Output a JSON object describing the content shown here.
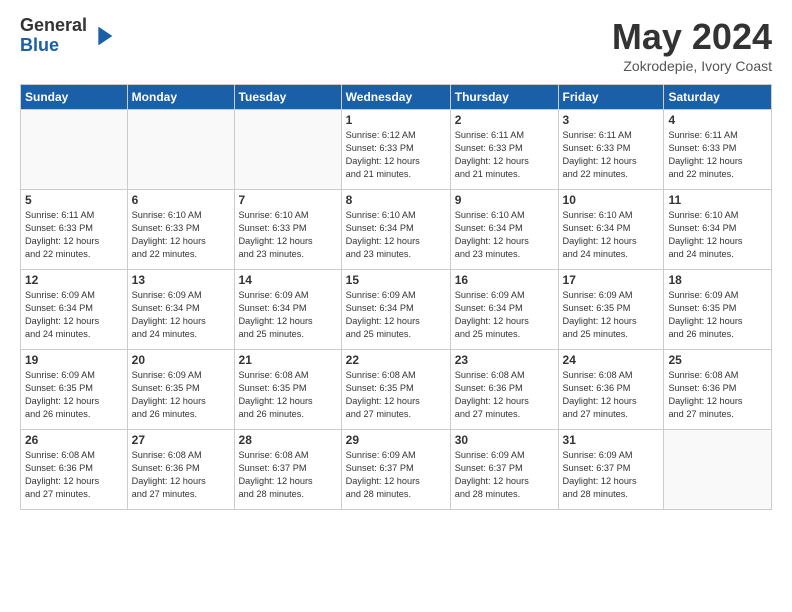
{
  "logo": {
    "general": "General",
    "blue": "Blue"
  },
  "title": "May 2024",
  "location": "Zokrodepie, Ivory Coast",
  "days": [
    "Sunday",
    "Monday",
    "Tuesday",
    "Wednesday",
    "Thursday",
    "Friday",
    "Saturday"
  ],
  "weeks": [
    [
      {
        "day": "",
        "content": ""
      },
      {
        "day": "",
        "content": ""
      },
      {
        "day": "",
        "content": ""
      },
      {
        "day": "1",
        "content": "Sunrise: 6:12 AM\nSunset: 6:33 PM\nDaylight: 12 hours\nand 21 minutes."
      },
      {
        "day": "2",
        "content": "Sunrise: 6:11 AM\nSunset: 6:33 PM\nDaylight: 12 hours\nand 21 minutes."
      },
      {
        "day": "3",
        "content": "Sunrise: 6:11 AM\nSunset: 6:33 PM\nDaylight: 12 hours\nand 22 minutes."
      },
      {
        "day": "4",
        "content": "Sunrise: 6:11 AM\nSunset: 6:33 PM\nDaylight: 12 hours\nand 22 minutes."
      }
    ],
    [
      {
        "day": "5",
        "content": "Sunrise: 6:11 AM\nSunset: 6:33 PM\nDaylight: 12 hours\nand 22 minutes."
      },
      {
        "day": "6",
        "content": "Sunrise: 6:10 AM\nSunset: 6:33 PM\nDaylight: 12 hours\nand 22 minutes."
      },
      {
        "day": "7",
        "content": "Sunrise: 6:10 AM\nSunset: 6:33 PM\nDaylight: 12 hours\nand 23 minutes."
      },
      {
        "day": "8",
        "content": "Sunrise: 6:10 AM\nSunset: 6:34 PM\nDaylight: 12 hours\nand 23 minutes."
      },
      {
        "day": "9",
        "content": "Sunrise: 6:10 AM\nSunset: 6:34 PM\nDaylight: 12 hours\nand 23 minutes."
      },
      {
        "day": "10",
        "content": "Sunrise: 6:10 AM\nSunset: 6:34 PM\nDaylight: 12 hours\nand 24 minutes."
      },
      {
        "day": "11",
        "content": "Sunrise: 6:10 AM\nSunset: 6:34 PM\nDaylight: 12 hours\nand 24 minutes."
      }
    ],
    [
      {
        "day": "12",
        "content": "Sunrise: 6:09 AM\nSunset: 6:34 PM\nDaylight: 12 hours\nand 24 minutes."
      },
      {
        "day": "13",
        "content": "Sunrise: 6:09 AM\nSunset: 6:34 PM\nDaylight: 12 hours\nand 24 minutes."
      },
      {
        "day": "14",
        "content": "Sunrise: 6:09 AM\nSunset: 6:34 PM\nDaylight: 12 hours\nand 25 minutes."
      },
      {
        "day": "15",
        "content": "Sunrise: 6:09 AM\nSunset: 6:34 PM\nDaylight: 12 hours\nand 25 minutes."
      },
      {
        "day": "16",
        "content": "Sunrise: 6:09 AM\nSunset: 6:34 PM\nDaylight: 12 hours\nand 25 minutes."
      },
      {
        "day": "17",
        "content": "Sunrise: 6:09 AM\nSunset: 6:35 PM\nDaylight: 12 hours\nand 25 minutes."
      },
      {
        "day": "18",
        "content": "Sunrise: 6:09 AM\nSunset: 6:35 PM\nDaylight: 12 hours\nand 26 minutes."
      }
    ],
    [
      {
        "day": "19",
        "content": "Sunrise: 6:09 AM\nSunset: 6:35 PM\nDaylight: 12 hours\nand 26 minutes."
      },
      {
        "day": "20",
        "content": "Sunrise: 6:09 AM\nSunset: 6:35 PM\nDaylight: 12 hours\nand 26 minutes."
      },
      {
        "day": "21",
        "content": "Sunrise: 6:08 AM\nSunset: 6:35 PM\nDaylight: 12 hours\nand 26 minutes."
      },
      {
        "day": "22",
        "content": "Sunrise: 6:08 AM\nSunset: 6:35 PM\nDaylight: 12 hours\nand 27 minutes."
      },
      {
        "day": "23",
        "content": "Sunrise: 6:08 AM\nSunset: 6:36 PM\nDaylight: 12 hours\nand 27 minutes."
      },
      {
        "day": "24",
        "content": "Sunrise: 6:08 AM\nSunset: 6:36 PM\nDaylight: 12 hours\nand 27 minutes."
      },
      {
        "day": "25",
        "content": "Sunrise: 6:08 AM\nSunset: 6:36 PM\nDaylight: 12 hours\nand 27 minutes."
      }
    ],
    [
      {
        "day": "26",
        "content": "Sunrise: 6:08 AM\nSunset: 6:36 PM\nDaylight: 12 hours\nand 27 minutes."
      },
      {
        "day": "27",
        "content": "Sunrise: 6:08 AM\nSunset: 6:36 PM\nDaylight: 12 hours\nand 27 minutes."
      },
      {
        "day": "28",
        "content": "Sunrise: 6:08 AM\nSunset: 6:37 PM\nDaylight: 12 hours\nand 28 minutes."
      },
      {
        "day": "29",
        "content": "Sunrise: 6:09 AM\nSunset: 6:37 PM\nDaylight: 12 hours\nand 28 minutes."
      },
      {
        "day": "30",
        "content": "Sunrise: 6:09 AM\nSunset: 6:37 PM\nDaylight: 12 hours\nand 28 minutes."
      },
      {
        "day": "31",
        "content": "Sunrise: 6:09 AM\nSunset: 6:37 PM\nDaylight: 12 hours\nand 28 minutes."
      },
      {
        "day": "",
        "content": ""
      }
    ]
  ]
}
